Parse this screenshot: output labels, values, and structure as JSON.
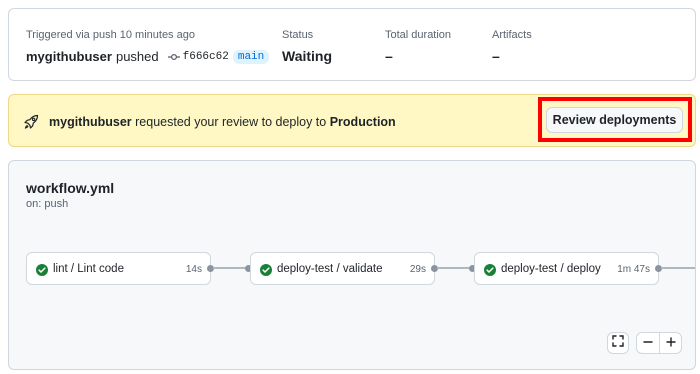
{
  "summary": {
    "triggered_label": "Triggered via push 10 minutes ago",
    "actor": "mygithubuser",
    "action": "pushed",
    "commit_sha": "f666c62",
    "branch": "main",
    "status_label": "Status",
    "status_value": "Waiting",
    "duration_label": "Total duration",
    "duration_value": "–",
    "artifacts_label": "Artifacts",
    "artifacts_value": "–"
  },
  "banner": {
    "user": "mygithubuser",
    "message": "requested your review to deploy to",
    "environment": "Production",
    "button_label": "Review deployments",
    "highlight_color": "#ff0000"
  },
  "workflow": {
    "name": "workflow.yml",
    "trigger": "on: push",
    "jobs": [
      {
        "name": "lint / Lint code",
        "duration": "14s",
        "status": "success"
      },
      {
        "name": "deploy-test / validate",
        "duration": "29s",
        "status": "success"
      },
      {
        "name": "deploy-test / deploy",
        "duration": "1m 47s",
        "status": "success"
      }
    ]
  },
  "colors": {
    "success": "#1a7f37",
    "branch_fg": "#0969da",
    "banner_bg": "#fff8c5"
  },
  "icons": {
    "commit": "git-commit-icon",
    "rocket": "rocket-icon",
    "check": "check-circle-icon",
    "fullscreen": "fullscreen-icon",
    "zoom_out": "minus-icon",
    "zoom_in": "plus-icon"
  }
}
